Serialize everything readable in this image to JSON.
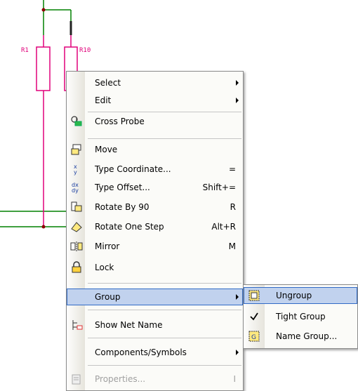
{
  "canvas": {
    "labels": {
      "r1": "R1",
      "r10": "R10"
    },
    "colors": {
      "component": "#e0007a",
      "wire": "#008000",
      "junction": "#8b0000"
    }
  },
  "context_menu": {
    "items": [
      {
        "label": "Select",
        "icon": "none",
        "has_submenu": true
      },
      {
        "label": "Edit",
        "icon": "none",
        "has_submenu": true
      },
      {
        "label": "Cross Probe",
        "icon": "cross-probe-icon"
      },
      {
        "label": "Move",
        "icon": "move-icon"
      },
      {
        "label": "Type Coordinate...",
        "shortcut": "=",
        "icon": "type-coordinate-icon"
      },
      {
        "label": "Type Offset...",
        "shortcut": "Shift+=",
        "icon": "type-offset-icon"
      },
      {
        "label": "Rotate By 90",
        "shortcut": "R",
        "icon": "rotate-90-icon"
      },
      {
        "label": "Rotate One Step",
        "shortcut": "Alt+R",
        "icon": "rotate-step-icon"
      },
      {
        "label": "Mirror",
        "shortcut": "M",
        "icon": "mirror-icon"
      },
      {
        "label": "Lock",
        "icon": "lock-icon"
      },
      {
        "label": "Group",
        "icon": "none",
        "has_submenu": true,
        "highlighted": true
      },
      {
        "label": "Show Net Name",
        "icon": "net-name-icon"
      },
      {
        "label": "Components/Symbols",
        "icon": "none",
        "has_submenu": true
      },
      {
        "label": "Properties...",
        "shortcut": "I",
        "icon": "properties-icon",
        "disabled": true
      }
    ]
  },
  "group_submenu": {
    "items": [
      {
        "label": "Ungroup",
        "icon": "ungroup-icon",
        "highlighted": true
      },
      {
        "label": "Tight Group",
        "icon": "checkmark-icon",
        "checked": true
      },
      {
        "label": "Name Group...",
        "icon": "name-group-icon"
      }
    ]
  }
}
